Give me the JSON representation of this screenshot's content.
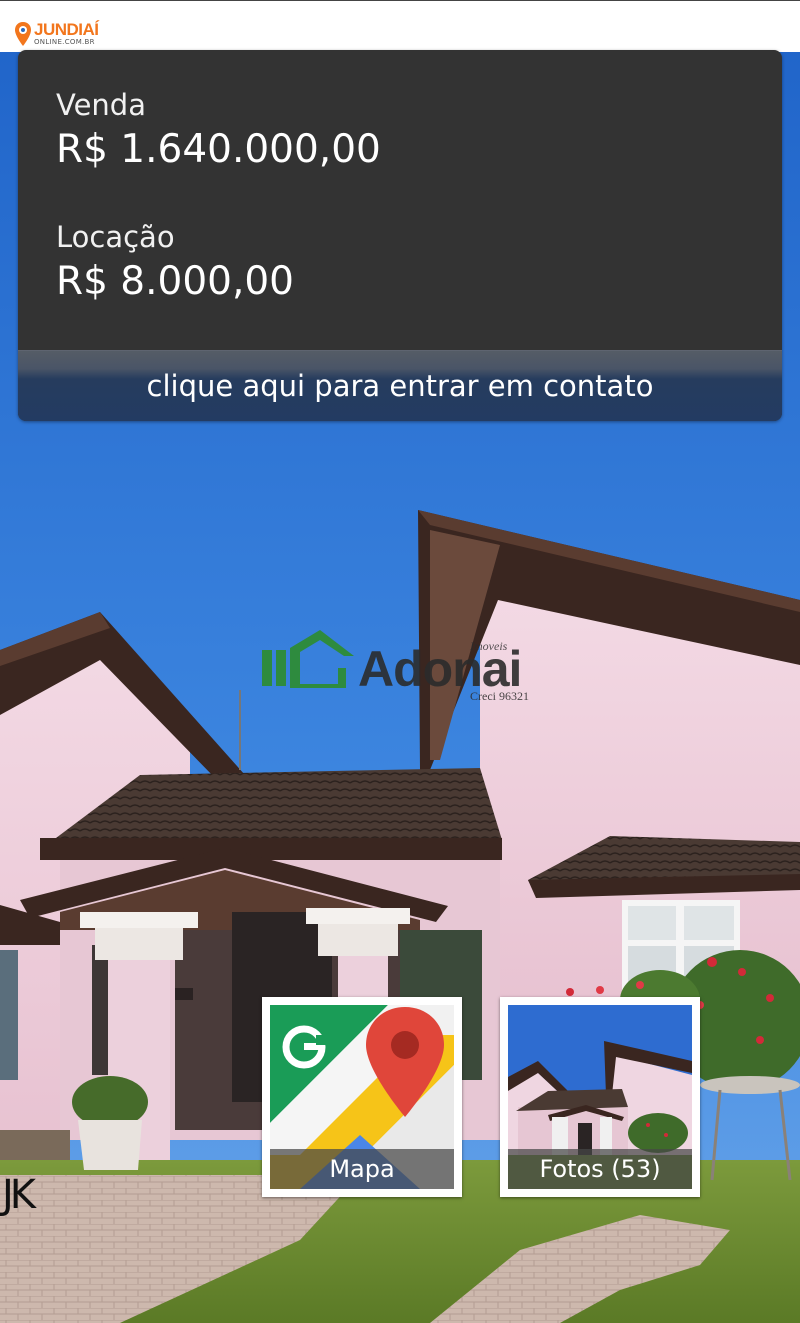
{
  "site": {
    "brand": "JUNDIAÍ",
    "domain": "ONLINE.COM.BR"
  },
  "prices": {
    "sale_label": "Venda",
    "sale_value": "R$ 1.640.000,00",
    "rent_label": "Locação",
    "rent_value": "R$ 8.000,00"
  },
  "contact": {
    "label": "clique aqui para entrar em contato"
  },
  "watermark": {
    "name": "Adonai",
    "subtitle": "Imoveis",
    "creci": "Creci 96321"
  },
  "photo_signature": "JK",
  "tiles": {
    "map_label": "Mapa",
    "map_icon": "google-maps-icon",
    "photos_label": "Fotos (53)"
  },
  "colors": {
    "card_bg": "#333333",
    "contact_bar": "#233b62",
    "brand_orange": "#f2761d",
    "watermark_green": "#2e8b3e"
  }
}
